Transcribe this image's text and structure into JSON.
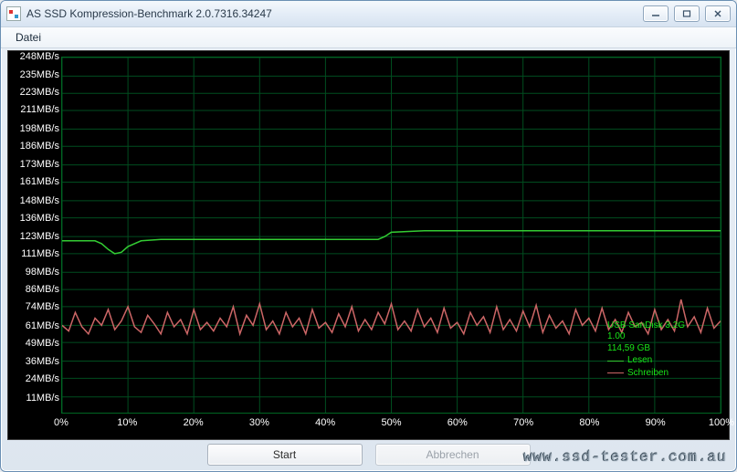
{
  "window": {
    "title": "AS SSD Kompression-Benchmark 2.0.7316.34247"
  },
  "menu": {
    "file": "Datei"
  },
  "buttons": {
    "start": "Start",
    "abort": "Abbrechen"
  },
  "legend": {
    "device": "USB  SanDisk 3.2G",
    "fw": "1.00",
    "size": "114,59 GB",
    "read": "Lesen",
    "write": "Schreiben"
  },
  "colors": {
    "grid": "#004d1f",
    "axis": "#007a2a",
    "read": "#33cc33",
    "write": "#cc6666"
  },
  "watermark": "www.ssd-tester.com.au",
  "chart_data": {
    "type": "line",
    "xlabel": "",
    "ylabel": "",
    "x_unit": "%",
    "y_unit": "MB/s",
    "xlim": [
      0,
      100
    ],
    "ylim": [
      0,
      248
    ],
    "y_ticks": [
      11,
      24,
      36,
      49,
      61,
      74,
      86,
      98,
      111,
      123,
      136,
      148,
      161,
      173,
      186,
      198,
      211,
      223,
      235,
      248
    ],
    "y_tick_labels": [
      "11MB/s",
      "24MB/s",
      "36MB/s",
      "49MB/s",
      "61MB/s",
      "74MB/s",
      "86MB/s",
      "98MB/s",
      "111MB/s",
      "123MB/s",
      "136MB/s",
      "148MB/s",
      "161MB/s",
      "173MB/s",
      "186MB/s",
      "198MB/s",
      "211MB/s",
      "223MB/s",
      "235MB/s",
      "248MB/s"
    ],
    "x_ticks": [
      0,
      10,
      20,
      30,
      40,
      50,
      60,
      70,
      80,
      90,
      100
    ],
    "x_tick_labels": [
      "0%",
      "10%",
      "20%",
      "30%",
      "40%",
      "50%",
      "60%",
      "70%",
      "80%",
      "90%",
      "100%"
    ],
    "series": [
      {
        "name": "Lesen",
        "color": "#33cc33",
        "x": [
          0,
          3,
          5,
          6,
          7,
          8,
          9,
          10,
          12,
          15,
          20,
          25,
          30,
          35,
          40,
          45,
          47,
          48,
          49,
          50,
          55,
          60,
          65,
          70,
          75,
          80,
          85,
          90,
          95,
          100
        ],
        "values": [
          120,
          120,
          120,
          118,
          114,
          111,
          112,
          116,
          120,
          121,
          121,
          121,
          121,
          121,
          121,
          121,
          121,
          121,
          123,
          126,
          127,
          127,
          127,
          127,
          127,
          127,
          127,
          127,
          127,
          127
        ]
      },
      {
        "name": "Schreiben",
        "color": "#cc6666",
        "x": [
          0,
          1,
          2,
          3,
          4,
          5,
          6,
          7,
          8,
          9,
          10,
          11,
          12,
          13,
          14,
          15,
          16,
          17,
          18,
          19,
          20,
          21,
          22,
          23,
          24,
          25,
          26,
          27,
          28,
          29,
          30,
          31,
          32,
          33,
          34,
          35,
          36,
          37,
          38,
          39,
          40,
          41,
          42,
          43,
          44,
          45,
          46,
          47,
          48,
          49,
          50,
          51,
          52,
          53,
          54,
          55,
          56,
          57,
          58,
          59,
          60,
          61,
          62,
          63,
          64,
          65,
          66,
          67,
          68,
          69,
          70,
          71,
          72,
          73,
          74,
          75,
          76,
          77,
          78,
          79,
          80,
          81,
          82,
          83,
          84,
          85,
          86,
          87,
          88,
          89,
          90,
          91,
          92,
          93,
          94,
          95,
          96,
          97,
          98,
          99,
          100
        ],
        "values": [
          61,
          57,
          70,
          60,
          55,
          66,
          61,
          72,
          58,
          64,
          74,
          60,
          56,
          68,
          62,
          55,
          70,
          60,
          65,
          55,
          72,
          58,
          63,
          57,
          66,
          60,
          74,
          55,
          68,
          61,
          76,
          58,
          64,
          55,
          70,
          60,
          66,
          55,
          72,
          59,
          63,
          56,
          69,
          60,
          74,
          57,
          65,
          58,
          70,
          62,
          76,
          58,
          64,
          57,
          72,
          60,
          66,
          56,
          73,
          59,
          63,
          55,
          70,
          61,
          67,
          56,
          74,
          58,
          65,
          57,
          71,
          60,
          75,
          56,
          68,
          59,
          64,
          55,
          72,
          61,
          66,
          57,
          73,
          58,
          65,
          56,
          70,
          60,
          63,
          55,
          72,
          58,
          65,
          57,
          79,
          60,
          67,
          56,
          73,
          59,
          64
        ]
      }
    ]
  }
}
